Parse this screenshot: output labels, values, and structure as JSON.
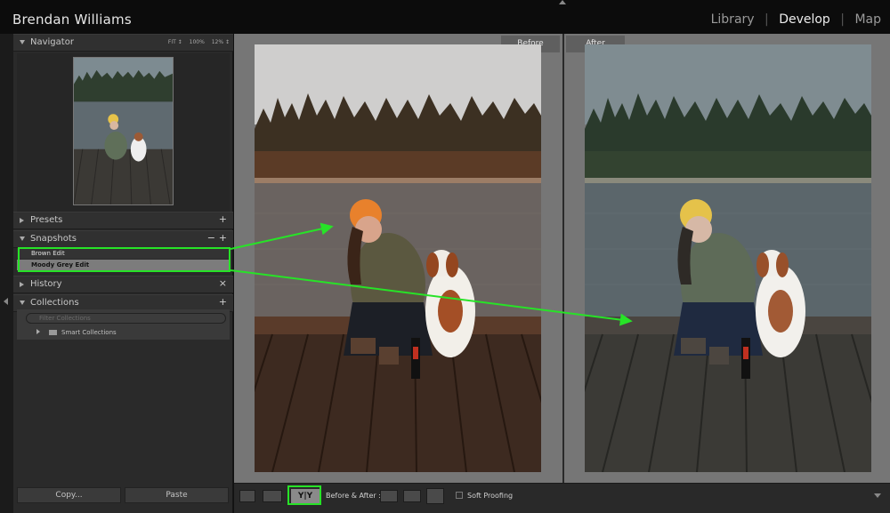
{
  "header": {
    "owner_name": "Brendan Williams",
    "modules": [
      {
        "label": "Library",
        "active": false
      },
      {
        "label": "Develop",
        "active": true
      },
      {
        "label": "Map",
        "active": false
      }
    ],
    "separator": "|"
  },
  "left_panel": {
    "navigator": {
      "title": "Navigator",
      "zoom_options": [
        "FIT ↕",
        "100%",
        "12% ↕"
      ],
      "thumbnail_icon": "photo-thumbnail"
    },
    "presets": {
      "title": "Presets",
      "action": "+"
    },
    "snapshots": {
      "title": "Snapshots",
      "actions": [
        "−",
        "+"
      ],
      "items": [
        {
          "label": "Brown Edit",
          "selected": false
        },
        {
          "label": "Moody Grey Edit",
          "selected": true
        }
      ]
    },
    "history": {
      "title": "History",
      "action": "×"
    },
    "collections": {
      "title": "Collections",
      "action": "+",
      "filter_placeholder": "Filter Collections",
      "items": [
        {
          "label": "Smart Collections"
        }
      ]
    },
    "buttons": {
      "copy": "Copy...",
      "paste": "Paste"
    }
  },
  "main": {
    "before_label": "Before",
    "after_label": "After",
    "before_photo": {
      "sky": "#cfcecd",
      "water": "#66605e",
      "dock": "#3d2a20",
      "tone": "warm"
    },
    "after_photo": {
      "sky": "#7e8b90",
      "water": "#5b666b",
      "dock": "#3b3a36",
      "tone": "cool"
    }
  },
  "toolbar": {
    "view_mode_label": "Y|Y",
    "before_after_label": "Before & After :",
    "soft_proofing_label": "Soft Proofing"
  },
  "colors": {
    "highlight": "#27e327",
    "panel_bg": "#2a2a2a",
    "main_bg": "#767676"
  }
}
